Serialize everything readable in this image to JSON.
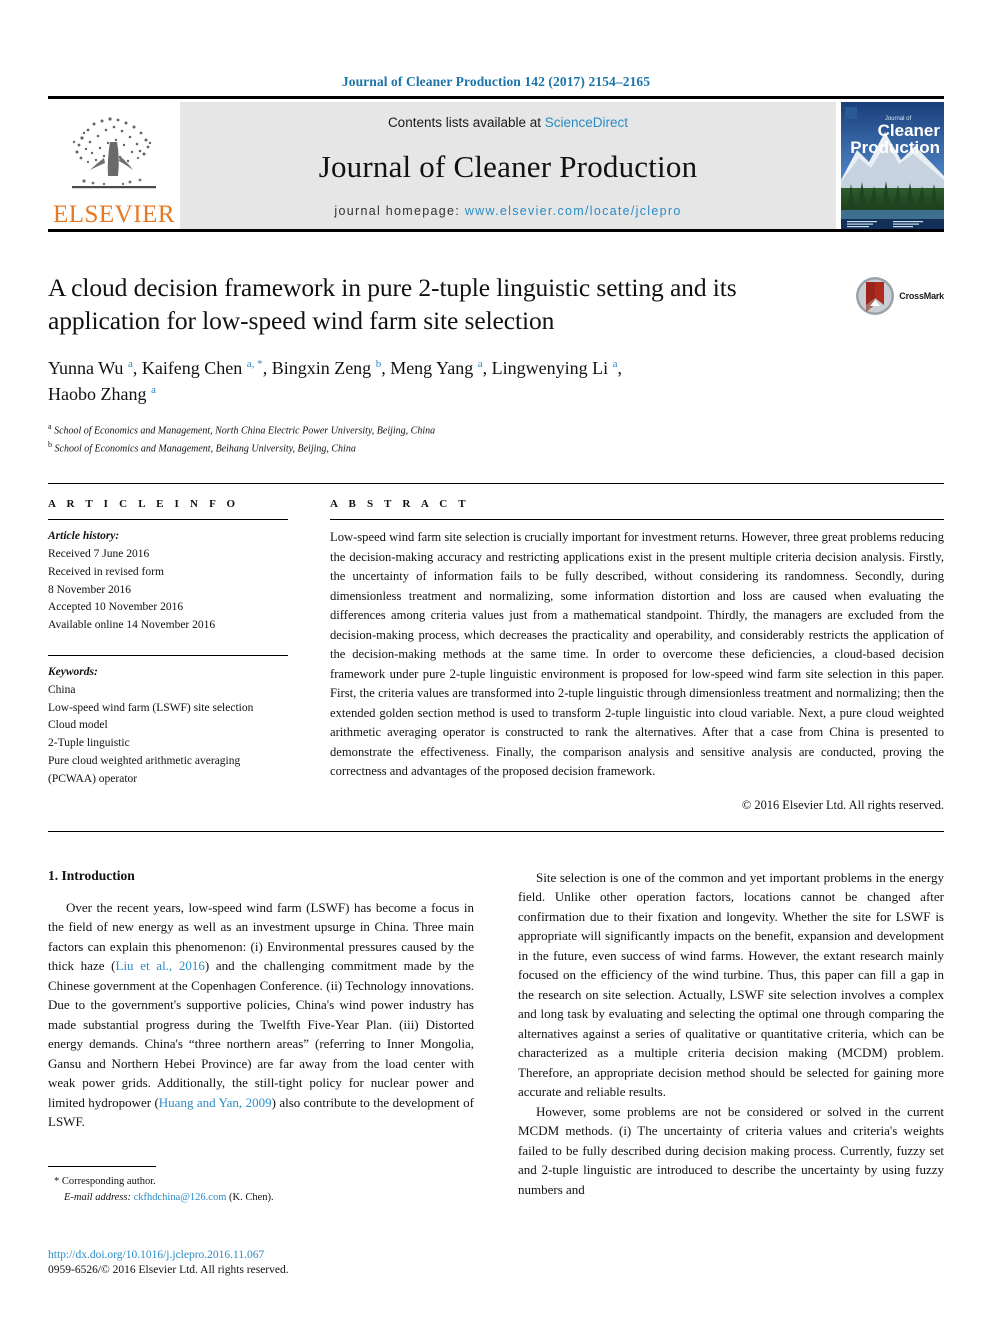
{
  "running_head": "Journal of Cleaner Production 142 (2017) 2154–2165",
  "masthead": {
    "publisher_name": "ELSEVIER",
    "contents_prefix": "Contents lists available at ",
    "contents_link": "ScienceDirect",
    "journal_name": "Journal of Cleaner Production",
    "homepage_prefix": "journal homepage: ",
    "homepage_url": "www.elsevier.com/locate/jclepro",
    "cover_title_small": "Journal of",
    "cover_title_line1": "Cleaner",
    "cover_title_line2": "Production"
  },
  "article": {
    "title": "A cloud decision framework in pure 2-tuple linguistic setting and its application for low-speed wind farm site selection",
    "authors_line1": "Yunna Wu <sup>a</sup>, Kaifeng Chen <sup>a, *</sup>, Bingxin Zeng <sup>b</sup>, Meng Yang <sup>a</sup>, Lingwenying Li <sup>a</sup>,",
    "authors_line2": "Haobo Zhang <sup>a</sup>",
    "affiliation_a": "School of Economics and Management, North China Electric Power University, Beijing, China",
    "affiliation_b": "School of Economics and Management, Beihang University, Beijing, China",
    "crossmark_label": "CrossMark"
  },
  "info": {
    "heading": "A R T I C L E    I N F O",
    "history_label": "Article history:",
    "history": [
      "Received 7 June 2016",
      "Received in revised form",
      "8 November 2016",
      "Accepted 10 November 2016",
      "Available online 14 November 2016"
    ],
    "keywords_label": "Keywords:",
    "keywords": [
      "China",
      "Low-speed wind farm (LSWF) site selection",
      "Cloud model",
      "2-Tuple linguistic",
      "Pure cloud weighted arithmetic averaging",
      "(PCWAA) operator"
    ]
  },
  "abstract": {
    "heading": "A B S T R A C T",
    "text": "Low-speed wind farm site selection is crucially important for investment returns. However, three great problems reducing the decision-making accuracy and restricting applications exist in the present multiple criteria decision analysis. Firstly, the uncertainty of information fails to be fully described, without considering its randomness. Secondly, during dimensionless treatment and normalizing, some information distortion and loss are caused when evaluating the differences among criteria values just from a mathematical standpoint. Thirdly, the managers are excluded from the decision-making process, which decreases the practicality and operability, and considerably restricts the application of the decision-making methods at the same time. In order to overcome these deficiencies, a cloud-based decision framework under pure 2-tuple linguistic environment is proposed for low-speed wind farm site selection in this paper. First, the criteria values are transformed into 2-tuple linguistic through dimensionless treatment and normalizing; then the extended golden section method is used to transform 2-tuple linguistic into cloud variable. Next, a pure cloud weighted arithmetic averaging operator is constructed to rank the alternatives. After that a case from China is presented to demonstrate the effectiveness. Finally, the comparison analysis and sensitive analysis are conducted, proving the correctness and advantages of the proposed decision framework.",
    "copyright": "© 2016 Elsevier Ltd. All rights reserved."
  },
  "body": {
    "section_title": "1. Introduction",
    "left_paragraph_1_html": "Over the recent years, low-speed wind farm (LSWF) has become a focus in the field of new energy as well as an investment upsurge in China. Three main factors can explain this phenomenon: (i) Environmental pressures caused by the thick haze (<span class=\"cite\">Liu et al., 2016</span>) and the challenging commitment made by the Chinese government at the Copenhagen Conference. (ii) Technology innovations. Due to the government's supportive policies, China's wind power industry has made substantial progress during the Twelfth Five-Year Plan. (iii) Distorted energy demands. China's “three northern areas” (referring to Inner Mongolia, Gansu and Northern Hebei Province) are far away from the load center with weak power grids. Additionally, the still-tight policy for nuclear power and limited hydropower (<span class=\"cite\">Huang and Yan, 2009</span>) also contribute to the development of LSWF.",
    "right_paragraph_1_html": "Site selection is one of the common and yet important problems in the energy field. Unlike other operation factors, locations cannot be changed after confirmation due to their fixation and longevity. Whether the site for LSWF is appropriate will significantly impacts on the benefit, expansion and development in the future, even success of wind farms. However, the extant research mainly focused on the efficiency of the wind turbine. Thus, this paper can fill a gap in the research on site selection. Actually, LSWF site selection involves a complex and long task by evaluating and selecting the optimal one through comparing the alternatives against a series of qualitative or quantitative criteria, which can be characterized as a multiple criteria decision making (MCDM) problem. Therefore, an appropriate decision method should be selected for gaining more accurate and reliable results.",
    "right_paragraph_2_html": "However, some problems are not be considered or solved in the current MCDM methods. (i) The uncertainty of criteria values and criteria's weights failed to be fully described during decision making process. Currently, fuzzy set and 2-tuple linguistic are introduced to describe the uncertainty by using fuzzy numbers and"
  },
  "footnote": {
    "corresponding": "* Corresponding author.",
    "email_label": "E-mail address: ",
    "email": "ckfhdchina@126.com",
    "email_suffix": " (K. Chen)."
  },
  "footer": {
    "doi": "http://dx.doi.org/10.1016/j.jclepro.2016.11.067",
    "issn": "0959-6526/© 2016 Elsevier Ltd. All rights reserved."
  },
  "colors": {
    "link_blue": "#2b8bc4",
    "header_blue": "#1a74a8",
    "elsevier_orange": "#e87722",
    "masthead_gray": "#e6e6e6"
  }
}
